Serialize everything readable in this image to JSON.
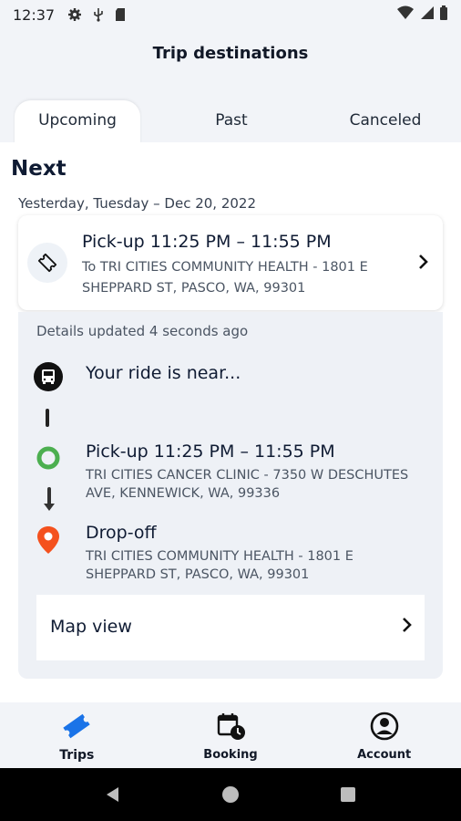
{
  "status_bar": {
    "time": "12:37",
    "icons": [
      "settings-icon",
      "usb-icon",
      "sd-card-icon",
      "wifi-icon",
      "signal-icon",
      "battery-icon"
    ]
  },
  "header": {
    "title": "Trip destinations"
  },
  "tabs": [
    {
      "label": "Upcoming",
      "active": true
    },
    {
      "label": "Past",
      "active": false
    },
    {
      "label": "Canceled",
      "active": false
    }
  ],
  "section": {
    "heading": "Next",
    "date": "Yesterday, Tuesday – Dec 20, 2022"
  },
  "trip_card": {
    "icon": "ticket-icon",
    "title": "Pick-up 11:25 PM – 11:55 PM",
    "destination": "To TRI CITIES COMMUNITY HEALTH - 1801 E SHEPPARD ST, PASCO, WA, 99301"
  },
  "details": {
    "updated": "Details updated 4 seconds ago",
    "steps": [
      {
        "icon": "bus-icon",
        "title": "Your ride is near..."
      },
      {
        "icon": "pickup-circle-icon",
        "title": "Pick-up 11:25 PM – 11:55 PM",
        "address": "TRI CITIES CANCER CLINIC - 7350 W DESCHUTES AVE, KENNEWICK, WA, 99336"
      },
      {
        "icon": "location-pin-icon",
        "title": "Drop-off",
        "address": "TRI CITIES COMMUNITY HEALTH - 1801 E SHEPPARD ST, PASCO, WA, 99301"
      }
    ],
    "map_view_label": "Map view"
  },
  "bottom_nav": [
    {
      "label": "Trips",
      "icon": "ticket-icon",
      "selected": true
    },
    {
      "label": "Booking",
      "icon": "calendar-clock-icon",
      "selected": false
    },
    {
      "label": "Account",
      "icon": "account-circle-icon",
      "selected": false
    }
  ],
  "colors": {
    "accent_blue": "#1a73e8",
    "pickup_green": "#4caf50",
    "dropoff_orange": "#f4511e",
    "text_dark": "#0f1b33"
  }
}
